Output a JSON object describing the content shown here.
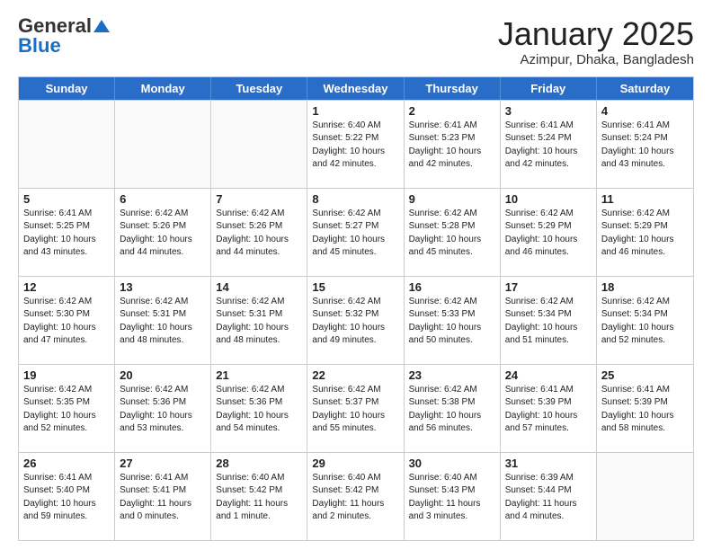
{
  "logo": {
    "general": "General",
    "blue": "Blue"
  },
  "header": {
    "month": "January 2025",
    "location": "Azimpur, Dhaka, Bangladesh"
  },
  "weekdays": [
    "Sunday",
    "Monday",
    "Tuesday",
    "Wednesday",
    "Thursday",
    "Friday",
    "Saturday"
  ],
  "rows": [
    [
      {
        "day": "",
        "info": ""
      },
      {
        "day": "",
        "info": ""
      },
      {
        "day": "",
        "info": ""
      },
      {
        "day": "1",
        "info": "Sunrise: 6:40 AM\nSunset: 5:22 PM\nDaylight: 10 hours\nand 42 minutes."
      },
      {
        "day": "2",
        "info": "Sunrise: 6:41 AM\nSunset: 5:23 PM\nDaylight: 10 hours\nand 42 minutes."
      },
      {
        "day": "3",
        "info": "Sunrise: 6:41 AM\nSunset: 5:24 PM\nDaylight: 10 hours\nand 42 minutes."
      },
      {
        "day": "4",
        "info": "Sunrise: 6:41 AM\nSunset: 5:24 PM\nDaylight: 10 hours\nand 43 minutes."
      }
    ],
    [
      {
        "day": "5",
        "info": "Sunrise: 6:41 AM\nSunset: 5:25 PM\nDaylight: 10 hours\nand 43 minutes."
      },
      {
        "day": "6",
        "info": "Sunrise: 6:42 AM\nSunset: 5:26 PM\nDaylight: 10 hours\nand 44 minutes."
      },
      {
        "day": "7",
        "info": "Sunrise: 6:42 AM\nSunset: 5:26 PM\nDaylight: 10 hours\nand 44 minutes."
      },
      {
        "day": "8",
        "info": "Sunrise: 6:42 AM\nSunset: 5:27 PM\nDaylight: 10 hours\nand 45 minutes."
      },
      {
        "day": "9",
        "info": "Sunrise: 6:42 AM\nSunset: 5:28 PM\nDaylight: 10 hours\nand 45 minutes."
      },
      {
        "day": "10",
        "info": "Sunrise: 6:42 AM\nSunset: 5:29 PM\nDaylight: 10 hours\nand 46 minutes."
      },
      {
        "day": "11",
        "info": "Sunrise: 6:42 AM\nSunset: 5:29 PM\nDaylight: 10 hours\nand 46 minutes."
      }
    ],
    [
      {
        "day": "12",
        "info": "Sunrise: 6:42 AM\nSunset: 5:30 PM\nDaylight: 10 hours\nand 47 minutes."
      },
      {
        "day": "13",
        "info": "Sunrise: 6:42 AM\nSunset: 5:31 PM\nDaylight: 10 hours\nand 48 minutes."
      },
      {
        "day": "14",
        "info": "Sunrise: 6:42 AM\nSunset: 5:31 PM\nDaylight: 10 hours\nand 48 minutes."
      },
      {
        "day": "15",
        "info": "Sunrise: 6:42 AM\nSunset: 5:32 PM\nDaylight: 10 hours\nand 49 minutes."
      },
      {
        "day": "16",
        "info": "Sunrise: 6:42 AM\nSunset: 5:33 PM\nDaylight: 10 hours\nand 50 minutes."
      },
      {
        "day": "17",
        "info": "Sunrise: 6:42 AM\nSunset: 5:34 PM\nDaylight: 10 hours\nand 51 minutes."
      },
      {
        "day": "18",
        "info": "Sunrise: 6:42 AM\nSunset: 5:34 PM\nDaylight: 10 hours\nand 52 minutes."
      }
    ],
    [
      {
        "day": "19",
        "info": "Sunrise: 6:42 AM\nSunset: 5:35 PM\nDaylight: 10 hours\nand 52 minutes."
      },
      {
        "day": "20",
        "info": "Sunrise: 6:42 AM\nSunset: 5:36 PM\nDaylight: 10 hours\nand 53 minutes."
      },
      {
        "day": "21",
        "info": "Sunrise: 6:42 AM\nSunset: 5:36 PM\nDaylight: 10 hours\nand 54 minutes."
      },
      {
        "day": "22",
        "info": "Sunrise: 6:42 AM\nSunset: 5:37 PM\nDaylight: 10 hours\nand 55 minutes."
      },
      {
        "day": "23",
        "info": "Sunrise: 6:42 AM\nSunset: 5:38 PM\nDaylight: 10 hours\nand 56 minutes."
      },
      {
        "day": "24",
        "info": "Sunrise: 6:41 AM\nSunset: 5:39 PM\nDaylight: 10 hours\nand 57 minutes."
      },
      {
        "day": "25",
        "info": "Sunrise: 6:41 AM\nSunset: 5:39 PM\nDaylight: 10 hours\nand 58 minutes."
      }
    ],
    [
      {
        "day": "26",
        "info": "Sunrise: 6:41 AM\nSunset: 5:40 PM\nDaylight: 10 hours\nand 59 minutes."
      },
      {
        "day": "27",
        "info": "Sunrise: 6:41 AM\nSunset: 5:41 PM\nDaylight: 11 hours\nand 0 minutes."
      },
      {
        "day": "28",
        "info": "Sunrise: 6:40 AM\nSunset: 5:42 PM\nDaylight: 11 hours\nand 1 minute."
      },
      {
        "day": "29",
        "info": "Sunrise: 6:40 AM\nSunset: 5:42 PM\nDaylight: 11 hours\nand 2 minutes."
      },
      {
        "day": "30",
        "info": "Sunrise: 6:40 AM\nSunset: 5:43 PM\nDaylight: 11 hours\nand 3 minutes."
      },
      {
        "day": "31",
        "info": "Sunrise: 6:39 AM\nSunset: 5:44 PM\nDaylight: 11 hours\nand 4 minutes."
      },
      {
        "day": "",
        "info": ""
      }
    ]
  ]
}
